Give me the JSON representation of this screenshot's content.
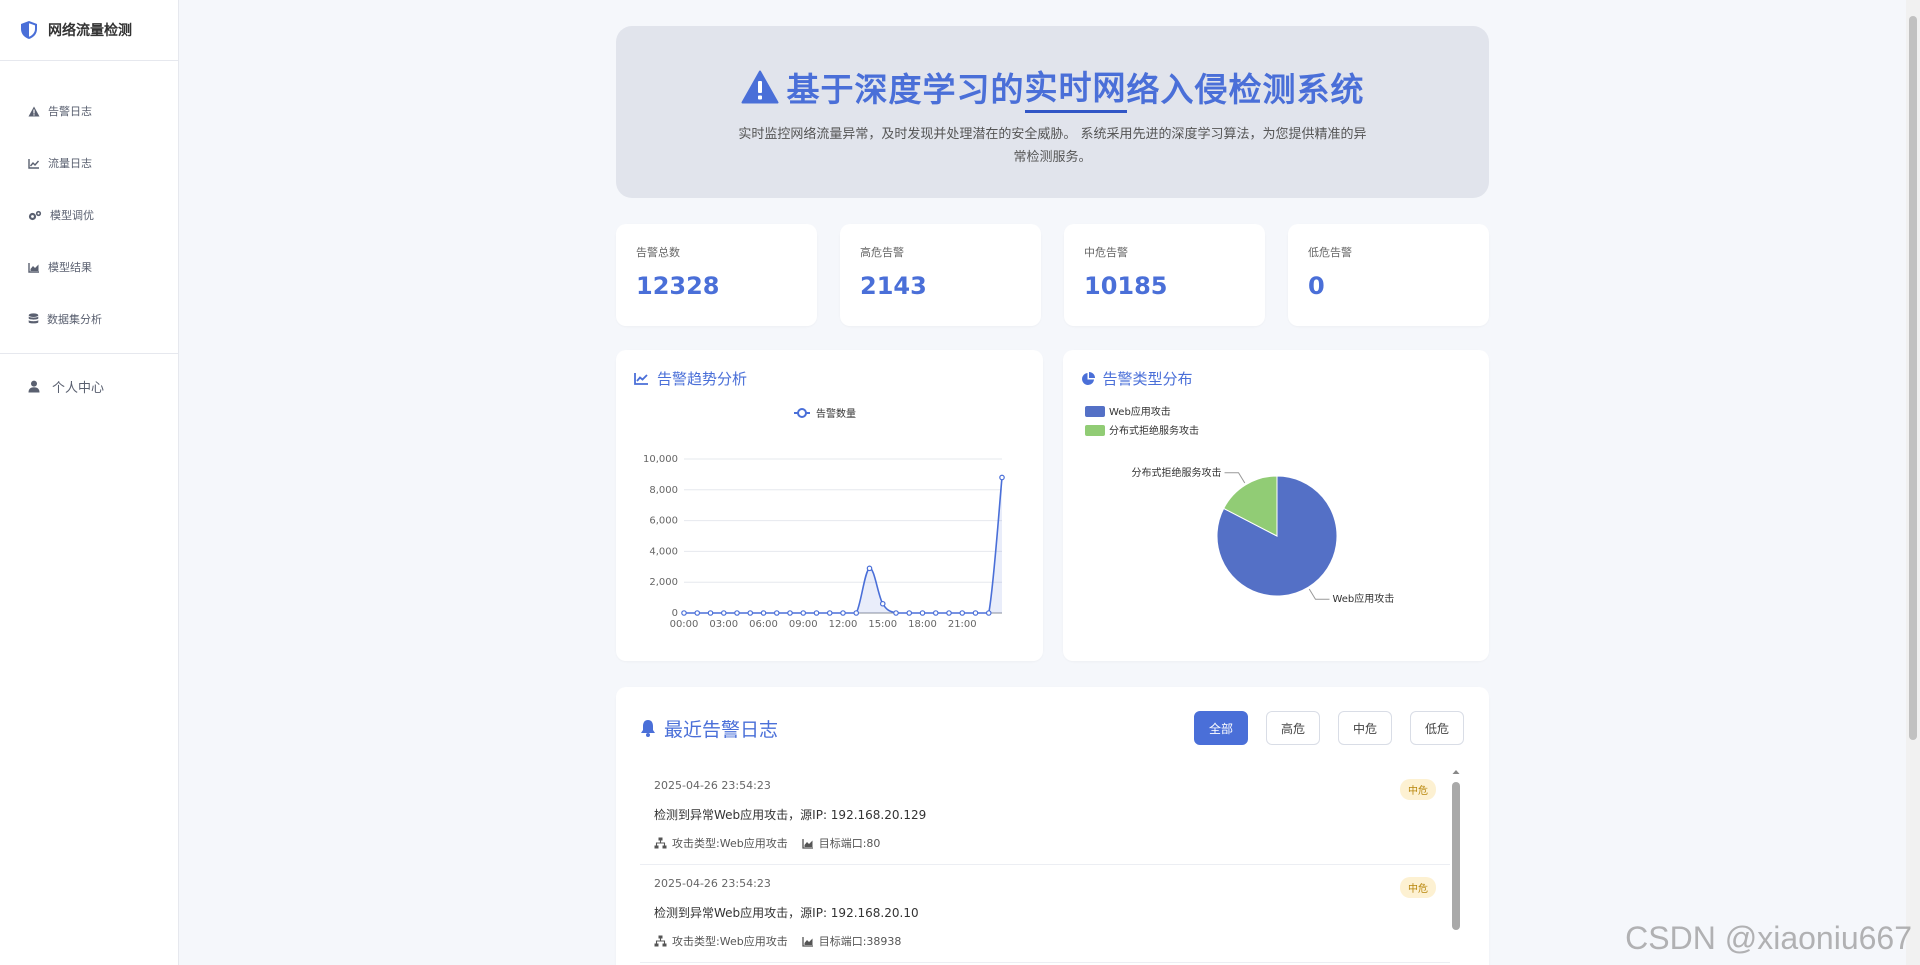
{
  "sidebar": {
    "brand": "网络流量检测",
    "items": [
      {
        "label": "告警日志",
        "icon": "warning-icon"
      },
      {
        "label": "流量日志",
        "icon": "line-chart-icon"
      },
      {
        "label": "模型调优",
        "icon": "gears-icon"
      },
      {
        "label": "模型结果",
        "icon": "area-chart-icon"
      },
      {
        "label": "数据集分析",
        "icon": "database-icon"
      }
    ],
    "personal": "个人中心"
  },
  "hero": {
    "title_pre": "基于深度学习的",
    "title_mid": "实时网",
    "title_post": "络入侵检测系统",
    "desc": "实时监控网络流量异常，及时发现并处理潜在的安全威胁。 系统采用先进的深度学习算法，为您提供精准的异常检测服务。"
  },
  "stats": [
    {
      "label": "告警总数",
      "value": "12328"
    },
    {
      "label": "高危告警",
      "value": "2143"
    },
    {
      "label": "中危告警",
      "value": "10185"
    },
    {
      "label": "低危告警",
      "value": "0"
    }
  ],
  "trend": {
    "title": "告警趋势分析",
    "chart_data": {
      "type": "line",
      "series": [
        {
          "name": "告警数量",
          "values": [
            0,
            0,
            0,
            0,
            0,
            0,
            0,
            0,
            0,
            0,
            0,
            0,
            0,
            0,
            2900,
            600,
            0,
            0,
            0,
            0,
            0,
            0,
            0,
            0,
            8800
          ]
        }
      ],
      "x_ticks": [
        "00:00",
        "03:00",
        "06:00",
        "09:00",
        "12:00",
        "15:00",
        "18:00",
        "21:00"
      ],
      "y_ticks": [
        "0",
        "2,000",
        "4,000",
        "6,000",
        "8,000",
        "10,000"
      ],
      "ylim": [
        0,
        10000
      ],
      "legend": "top-center",
      "color": "#4a6fd8"
    }
  },
  "pie": {
    "title": "告警类型分布",
    "chart_data": {
      "type": "pie",
      "labels": [
        "Web应用攻击",
        "分布式拒绝服务攻击"
      ],
      "values": [
        82.6,
        17.4
      ],
      "colors": [
        "#5470c6",
        "#91cc75"
      ],
      "legend": "top-left"
    }
  },
  "logs": {
    "title": "最近告警日志",
    "filters": [
      "全部",
      "高危",
      "中危",
      "低危"
    ],
    "type_label": "攻击类型: ",
    "port_label": "目标端口: ",
    "items": [
      {
        "time": "2025-04-26 23:54:23",
        "msg": "检测到异常Web应用攻击，源IP: 192.168.20.129",
        "type": "Web应用攻击",
        "port": "80",
        "level": "中危"
      },
      {
        "time": "2025-04-26 23:54:23",
        "msg": "检测到异常Web应用攻击，源IP: 192.168.20.10",
        "type": "Web应用攻击",
        "port": "38938",
        "level": "中危"
      }
    ]
  },
  "watermark": "CSDN @xiaoniu667"
}
